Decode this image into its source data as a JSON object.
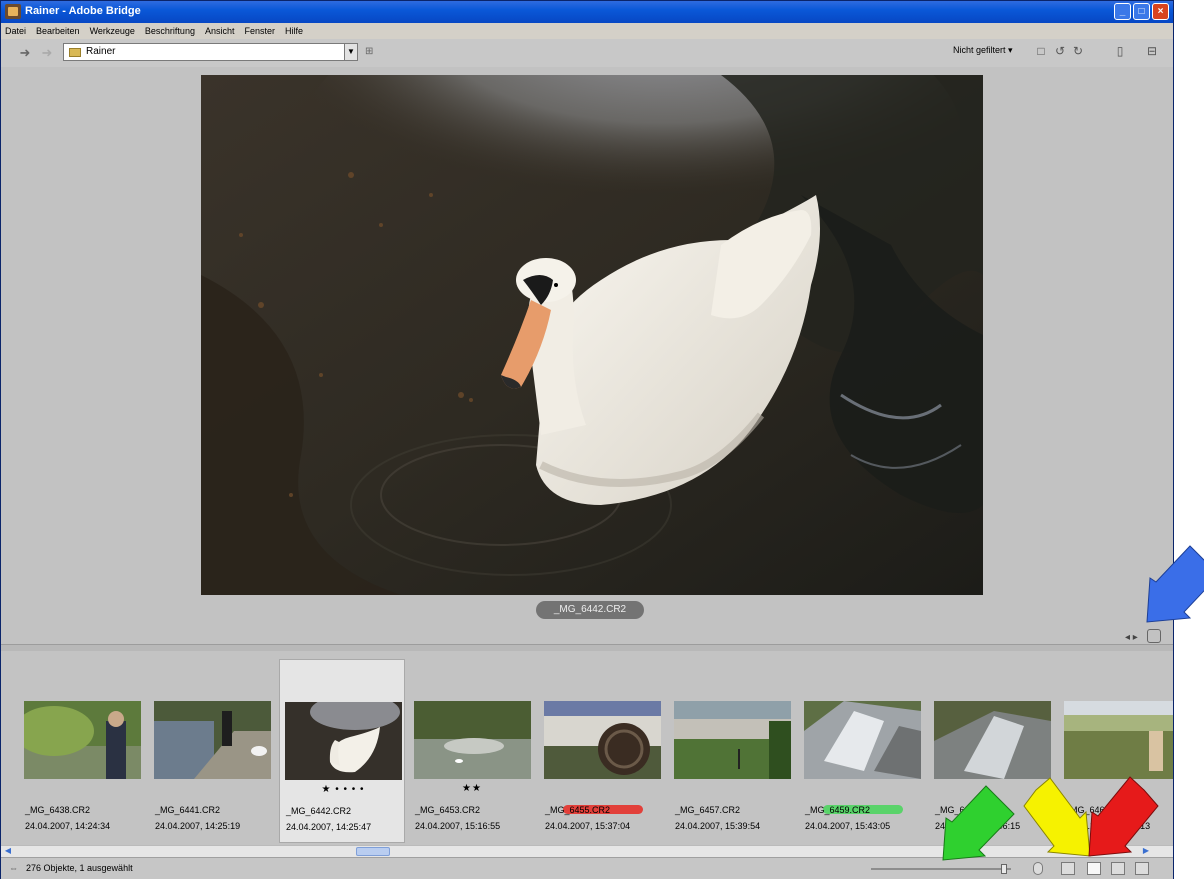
{
  "window": {
    "title": "Rainer - Adobe Bridge"
  },
  "menu": [
    "Datei",
    "Bearbeiten",
    "Werkzeuge",
    "Beschriftung",
    "Ansicht",
    "Fenster",
    "Hilfe"
  ],
  "toolbar": {
    "path": "Rainer",
    "filter": "Nicht gefiltert"
  },
  "preview": {
    "caption": "_MG_6442.CR2"
  },
  "thumbnails": [
    {
      "name": "_MG_6438.CR2",
      "date": "24.04.2007, 14:24:34",
      "stars": "",
      "label_color": "",
      "selected": false
    },
    {
      "name": "_MG_6441.CR2",
      "date": "24.04.2007, 14:25:19",
      "stars": "",
      "label_color": "",
      "selected": false
    },
    {
      "name": "_MG_6442.CR2",
      "date": "24.04.2007, 14:25:47",
      "stars": "★ • • • •",
      "label_color": "",
      "selected": true
    },
    {
      "name": "_MG_6453.CR2",
      "date": "24.04.2007, 15:16:55",
      "stars": "★★",
      "label_color": "",
      "selected": false
    },
    {
      "name": "_MG_6455.CR2",
      "date": "24.04.2007, 15:37:04",
      "stars": "",
      "label_color": "#e2403a",
      "selected": false
    },
    {
      "name": "_MG_6457.CR2",
      "date": "24.04.2007, 15:39:54",
      "stars": "",
      "label_color": "",
      "selected": false
    },
    {
      "name": "_MG_6459.CR2",
      "date": "24.04.2007, 15:43:05",
      "stars": "",
      "label_color": "#5ad36a",
      "selected": false
    },
    {
      "name": "_MG_6462.CR2",
      "date": "24.04.2007, 15:46:15",
      "stars": "",
      "label_color": "",
      "selected": false
    },
    {
      "name": "_MG_6463.CR2",
      "date": "24.04.2007, 15:46:13",
      "stars": "",
      "label_color": "",
      "selected": false
    }
  ],
  "status": {
    "text": "276 Objekte, 1 ausgewählt"
  },
  "annotations": {
    "arrow_colors": {
      "blue": "#3a6ee8",
      "green": "#2fd02f",
      "yellow": "#f6f200",
      "red": "#e61a1a"
    }
  }
}
